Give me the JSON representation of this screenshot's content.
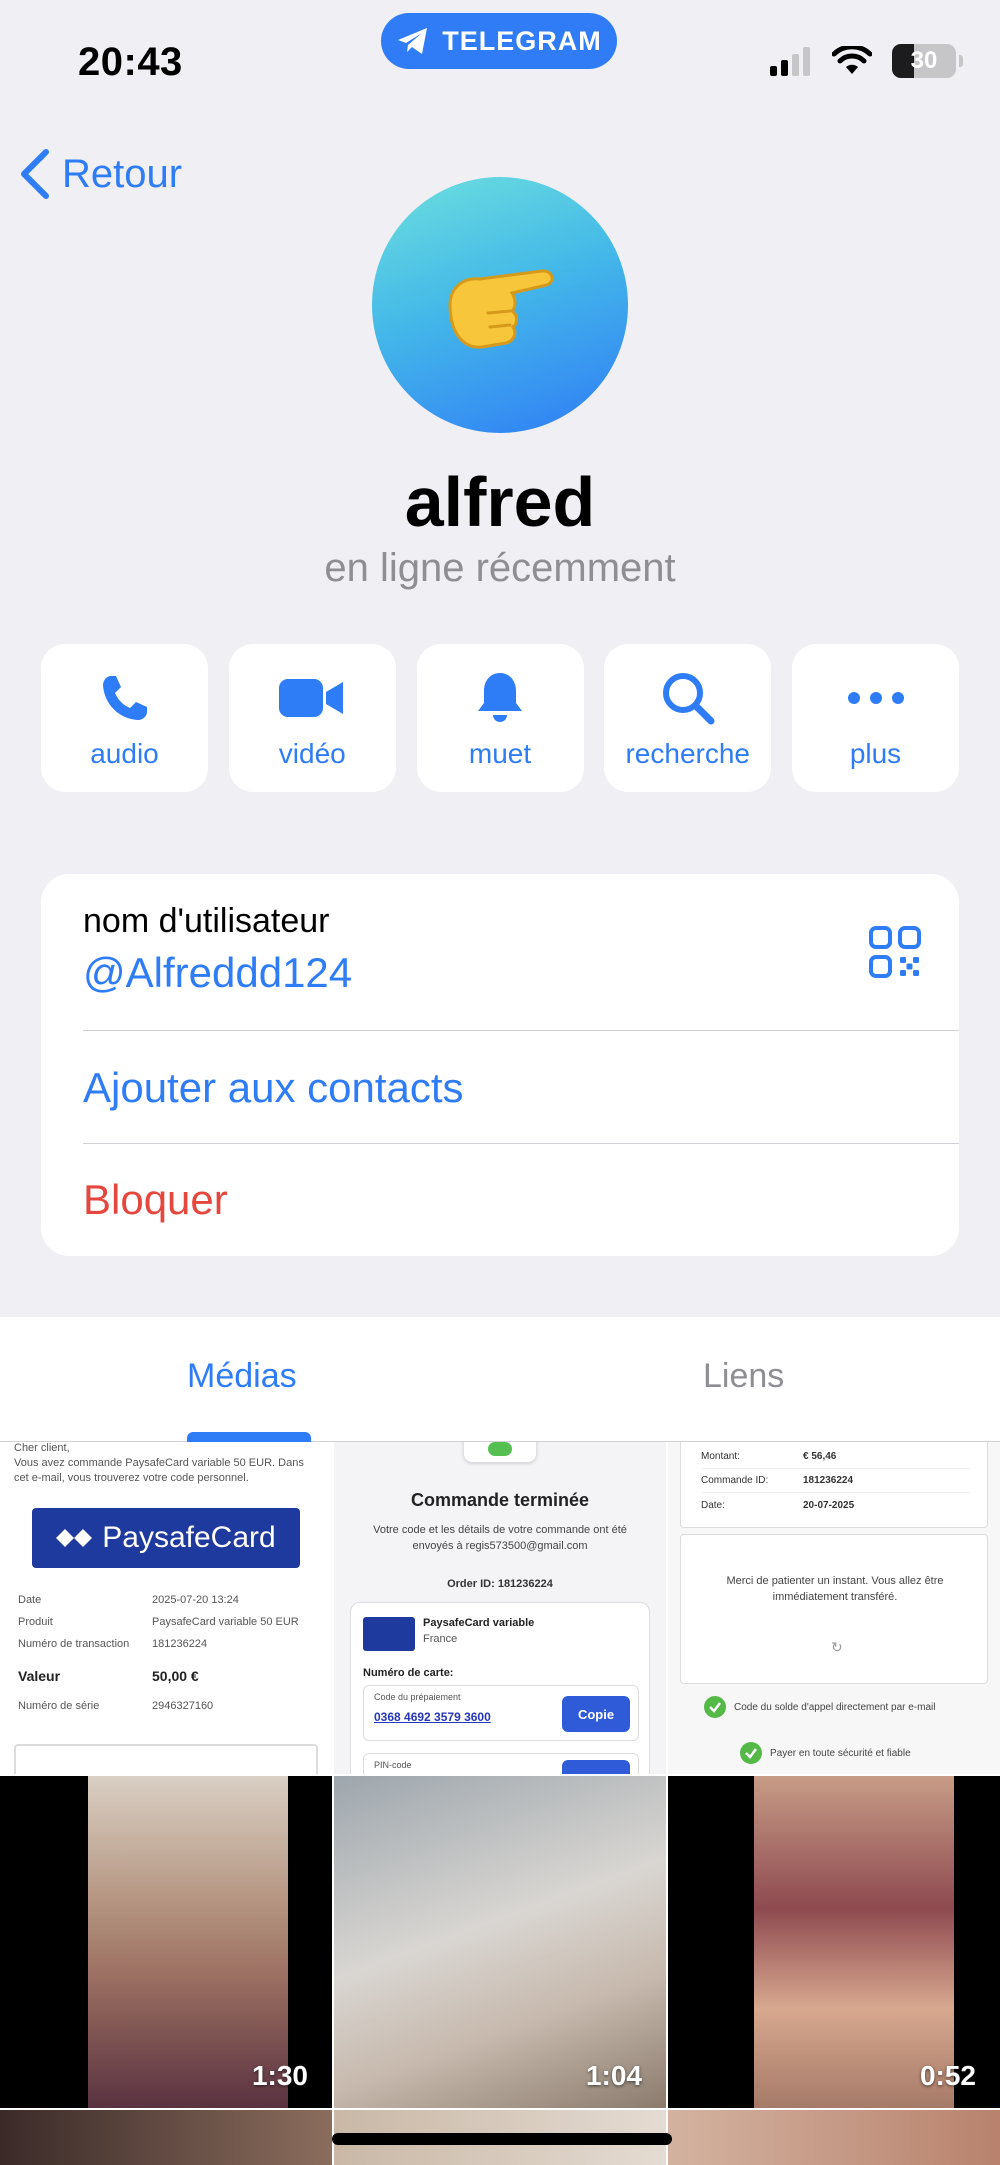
{
  "status_bar": {
    "time": "20:43",
    "app_pill": "TELEGRAM",
    "battery": "30"
  },
  "nav": {
    "back_label": "Retour"
  },
  "profile": {
    "name": "alfred",
    "status": "en ligne récemment"
  },
  "actions": [
    {
      "label": "audio",
      "icon": "phone-icon"
    },
    {
      "label": "vidéo",
      "icon": "video-camera-icon"
    },
    {
      "label": "muet",
      "icon": "bell-icon"
    },
    {
      "label": "recherche",
      "icon": "search-icon"
    },
    {
      "label": "plus",
      "icon": "more-dots-icon"
    }
  ],
  "info": {
    "username_label": "nom d'utilisateur",
    "username": "@Alfreddd124",
    "add_contact": "Ajouter aux contacts",
    "block": "Bloquer"
  },
  "tabs": [
    {
      "label": "Médias",
      "active": true
    },
    {
      "label": "Liens",
      "active": false
    }
  ],
  "media": {
    "receipt1": {
      "greeting": "Cher client,",
      "intro": "Vous avez commande PaysafeCard variable 50 EUR. Dans cet e-mail, vous trouverez votre code personnel.",
      "brand": "PaysafeCard",
      "rows": [
        {
          "k": "Date",
          "v": "2025-07-20 13:24"
        },
        {
          "k": "Produit",
          "v": "PaysafeCard variable 50 EUR"
        },
        {
          "k": "Numéro de transaction",
          "v": "181236224"
        }
      ],
      "value_label": "Valeur",
      "value": "50,00 €",
      "serial_label": "Numéro de série",
      "serial": "2946327160"
    },
    "receipt2": {
      "title": "Commande terminée",
      "body": "Votre code et les détails de votre commande ont été envoyés à regis573500@gmail.com",
      "order": "Order ID: 181236224",
      "product": "PaysafeCard variable",
      "country": "France",
      "card_label": "Numéro de carte:",
      "prepaid_label": "Code du prépaiement",
      "prepaid_code": "0368 4692 3579 3600",
      "copy": "Copie",
      "pin_label": "PIN-code"
    },
    "receipt3": {
      "rows": [
        {
          "k": "Montant:",
          "v": "€ 56,46"
        },
        {
          "k": "Commande ID:",
          "v": "181236224"
        },
        {
          "k": "Date:",
          "v": "20-07-2025"
        }
      ],
      "wait_text": "Merci de patienter un instant. Vous allez être immédiatement transféré.",
      "check1": "Code du solde d'appel directement par e-mail",
      "check2": "Payer en toute sécurité et fiable"
    },
    "videos": [
      {
        "duration": "1:30"
      },
      {
        "duration": "1:04"
      },
      {
        "duration": "0:52"
      }
    ]
  },
  "colors": {
    "accent": "#2e7cf6",
    "danger": "#e5473f",
    "background": "#efeff4"
  }
}
